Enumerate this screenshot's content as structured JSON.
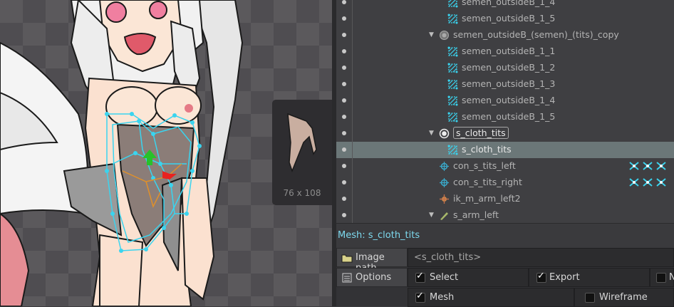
{
  "viewport": {
    "thumbnail_size": "76 x 108"
  },
  "tree": {
    "rows": [
      {
        "label": "semen_outsideB_1_4",
        "type": "mesh",
        "indent": 3,
        "faded": true
      },
      {
        "label": "semen_outsideB_1_5",
        "type": "mesh",
        "indent": 3,
        "faded": true
      },
      {
        "label": "semen_outsideB_(semen)_(tits)_copy",
        "type": "skin",
        "indent": 2,
        "expander": true,
        "faded": false
      },
      {
        "label": "semen_outsideB_1_1",
        "type": "mesh",
        "indent": 3,
        "faded": true
      },
      {
        "label": "semen_outsideB_1_2",
        "type": "mesh",
        "indent": 3,
        "faded": true
      },
      {
        "label": "semen_outsideB_1_3",
        "type": "mesh",
        "indent": 3,
        "faded": true
      },
      {
        "label": "semen_outsideB_1_4",
        "type": "mesh",
        "indent": 3,
        "faded": true
      },
      {
        "label": "semen_outsideB_1_5",
        "type": "mesh",
        "indent": 3,
        "faded": true
      },
      {
        "label": "s_cloth_tits",
        "type": "skin-active",
        "indent": 2,
        "expander": true,
        "boxed": true
      },
      {
        "label": "s_cloth_tits",
        "type": "mesh",
        "indent": 3,
        "selected": true,
        "bright": true
      },
      {
        "label": "con_s_tits_left",
        "type": "constraint",
        "indent": 2,
        "tools": true
      },
      {
        "label": "con_s_tits_right",
        "type": "constraint",
        "indent": 2,
        "tools": true
      },
      {
        "label": "ik_m_arm_left2",
        "type": "ik",
        "indent": 2
      },
      {
        "label": "s_arm_left",
        "type": "bone",
        "indent": 2,
        "expander": true
      }
    ]
  },
  "status": {
    "label": "Mesh: s_cloth_tits"
  },
  "props": {
    "image_path_label": "Image path",
    "image_path_value": "<s_cloth_tits>",
    "options_label": "Options",
    "select_label": "Select",
    "export_label": "Export",
    "third_label": "N",
    "mesh_label": "Mesh",
    "wireframe_label": "Wireframe",
    "select_checked": true,
    "export_checked": true,
    "mesh_checked": true,
    "wireframe_checked": false
  },
  "colors": {
    "mesh_wire": "#3ad4ef",
    "accent_text": "#7dd9ee",
    "selected_row": "#6b7778"
  }
}
